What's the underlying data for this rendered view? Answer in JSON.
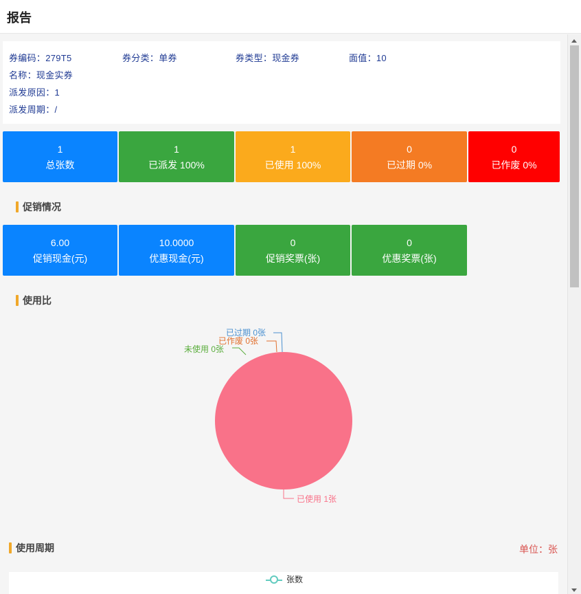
{
  "header": {
    "title": "报告"
  },
  "info": {
    "code_label": "券编码：",
    "code_value": "279T5",
    "category_label": "券分类：",
    "category_value": "单券",
    "type_label": "券类型：",
    "type_value": "现金券",
    "face_label": "面值：",
    "face_value": "10",
    "name_label": "名称：",
    "name_value": "现金实券",
    "reason_label": "派发原因：",
    "reason_value": "1",
    "period_label": "派发周期：",
    "period_value": "/"
  },
  "stats": [
    {
      "value": "1",
      "label": "总张数",
      "color": "#0a84ff"
    },
    {
      "value": "1",
      "label": "已派发 100%",
      "color": "#3aa63f"
    },
    {
      "value": "1",
      "label": "已使用 100%",
      "color": "#fbaa1c"
    },
    {
      "value": "0",
      "label": "已过期 0%",
      "color": "#f47b23"
    },
    {
      "value": "0",
      "label": "已作废 0%",
      "color": "#ff0000"
    }
  ],
  "promo": {
    "title": "促销情况",
    "items": [
      {
        "value": "6.00",
        "label": "促销现金(元)",
        "color": "#0a84ff"
      },
      {
        "value": "10.0000",
        "label": "优惠现金(元)",
        "color": "#0a84ff"
      },
      {
        "value": "0",
        "label": "促销奖票(张)",
        "color": "#3aa63f"
      },
      {
        "value": "0",
        "label": "优惠奖票(张)",
        "color": "#3aa63f"
      }
    ]
  },
  "usage": {
    "title": "使用比"
  },
  "chart_data": {
    "type": "pie",
    "slices": [
      {
        "label": "已使用 1张",
        "value": 1,
        "color": "#f97289"
      },
      {
        "label": "未使用 0张",
        "value": 0,
        "color": "#5aad3c"
      },
      {
        "label": "已作废 0张",
        "value": 0,
        "color": "#e1702e"
      },
      {
        "label": "已过期 0张",
        "value": 0,
        "color": "#4a90d0"
      }
    ]
  },
  "cycle": {
    "title": "使用周期",
    "unit": "单位：张",
    "legend": "张数",
    "legend_color": "#62cbbf"
  }
}
